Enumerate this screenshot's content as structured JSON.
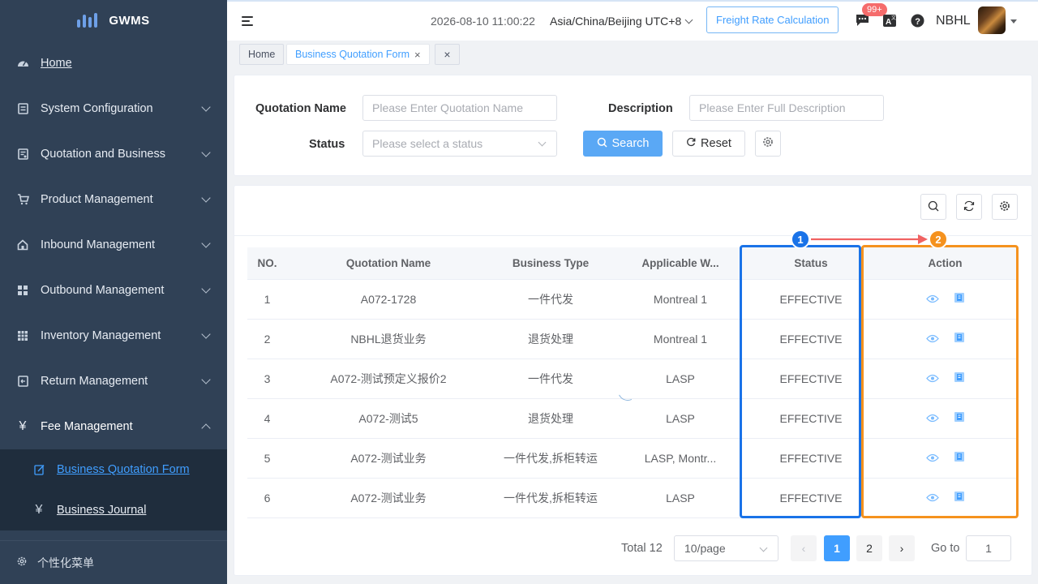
{
  "app": {
    "name": "GWMS"
  },
  "sidebar": {
    "home": "Home",
    "items": [
      {
        "label": "System Configuration",
        "icon": "settings-panel-icon"
      },
      {
        "label": "Quotation and Business",
        "icon": "document-list-icon"
      },
      {
        "label": "Product Management",
        "icon": "cart-icon"
      },
      {
        "label": "Inbound Management",
        "icon": "house-icon"
      },
      {
        "label": "Outbound Management",
        "icon": "grid-icon"
      },
      {
        "label": "Inventory Management",
        "icon": "table-icon"
      },
      {
        "label": "Return Management",
        "icon": "return-doc-icon"
      },
      {
        "label": "Fee Management",
        "icon": "yen-icon"
      }
    ],
    "sub_items": [
      {
        "label": "Business Quotation Form",
        "icon": "edit-doc-icon"
      },
      {
        "label": "Business Journal",
        "icon": "yen-icon"
      }
    ],
    "footer": "个性化菜单"
  },
  "topbar": {
    "datetime": "2026-08-10 11:00:22",
    "timezone": "Asia/China/Beijing UTC+8",
    "freight_button": "Freight Rate Calculation",
    "badge": "99+",
    "user": "NBHL"
  },
  "tags": {
    "home": "Home",
    "active": "Business Quotation Form"
  },
  "search": {
    "quotation_name_label": "Quotation Name",
    "quotation_name_placeholder": "Please Enter Quotation Name",
    "description_label": "Description",
    "description_placeholder": "Please Enter Full Description",
    "status_label": "Status",
    "status_placeholder": "Please select a status",
    "search_button": "Search",
    "reset_button": "Reset"
  },
  "table": {
    "columns": [
      "NO.",
      "Quotation Name",
      "Business Type",
      "Applicable W...",
      "Status",
      "Action"
    ],
    "rows": [
      {
        "no": "1",
        "name": "A072-1728",
        "type": "一件代发",
        "warehouse": "Montreal 1",
        "status": "EFFECTIVE"
      },
      {
        "no": "2",
        "name": "NBHL退货业务",
        "type": "退货处理",
        "warehouse": "Montreal 1",
        "status": "EFFECTIVE"
      },
      {
        "no": "3",
        "name": "A072-测试预定义报价2",
        "type": "一件代发",
        "warehouse": "LASP",
        "status": "EFFECTIVE"
      },
      {
        "no": "4",
        "name": "A072-测试5",
        "type": "退货处理",
        "warehouse": "LASP",
        "status": "EFFECTIVE"
      },
      {
        "no": "5",
        "name": "A072-测试业务",
        "type": "一件代发,拆柜转运",
        "warehouse": "LASP, Montr...",
        "status": "EFFECTIVE"
      },
      {
        "no": "6",
        "name": "A072-测试业务",
        "type": "一件代发,拆柜转运",
        "warehouse": "LASP",
        "status": "EFFECTIVE"
      }
    ]
  },
  "annotations": {
    "marker1": "1",
    "marker2": "2",
    "color1": "#1a73e8",
    "color2": "#f5921e",
    "arrow_color": "#f06262"
  },
  "pagination": {
    "total": "Total 12",
    "page_size": "10/page",
    "pages": [
      "1",
      "2"
    ],
    "current": "1",
    "goto_label": "Go to",
    "goto_value": "1"
  }
}
